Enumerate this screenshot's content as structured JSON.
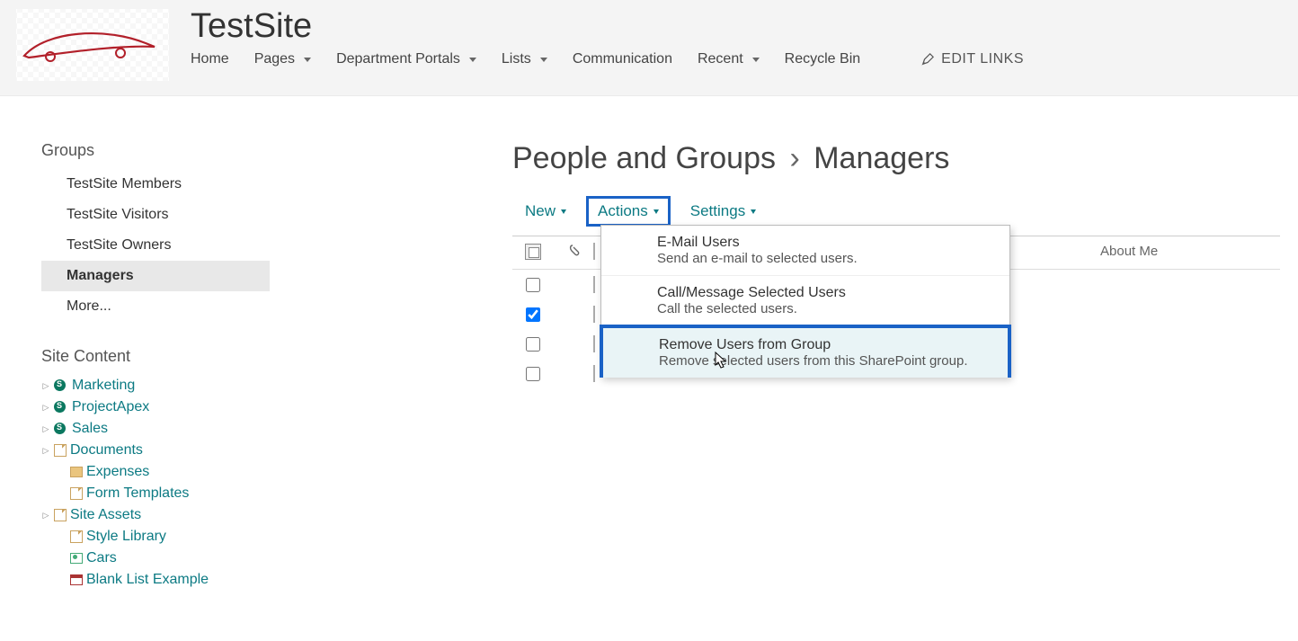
{
  "site_title": "TestSite",
  "top_nav": {
    "items": [
      {
        "label": "Home",
        "dropdown": false
      },
      {
        "label": "Pages",
        "dropdown": true
      },
      {
        "label": "Department Portals",
        "dropdown": true
      },
      {
        "label": "Lists",
        "dropdown": true
      },
      {
        "label": "Communication",
        "dropdown": false
      },
      {
        "label": "Recent",
        "dropdown": true
      },
      {
        "label": "Recycle Bin",
        "dropdown": false
      }
    ],
    "edit_links": "EDIT LINKS"
  },
  "sidebar": {
    "groups_heading": "Groups",
    "groups": [
      {
        "label": "TestSite Members",
        "active": false
      },
      {
        "label": "TestSite Visitors",
        "active": false
      },
      {
        "label": "TestSite Owners",
        "active": false
      },
      {
        "label": "Managers",
        "active": true
      },
      {
        "label": "More...",
        "active": false
      }
    ],
    "site_content_heading": "Site Content",
    "site_content": [
      {
        "label": "Marketing",
        "icon": "site",
        "tri": true,
        "indent": false
      },
      {
        "label": "ProjectApex",
        "icon": "site",
        "tri": true,
        "indent": false
      },
      {
        "label": "Sales",
        "icon": "site",
        "tri": true,
        "indent": false
      },
      {
        "label": "Documents",
        "icon": "doc",
        "tri": true,
        "indent": false
      },
      {
        "label": "Expenses",
        "icon": "folder",
        "tri": false,
        "indent": true
      },
      {
        "label": "Form Templates",
        "icon": "doc",
        "tri": false,
        "indent": true
      },
      {
        "label": "Site Assets",
        "icon": "doc",
        "tri": true,
        "indent": false
      },
      {
        "label": "Style Library",
        "icon": "doc",
        "tri": false,
        "indent": true
      },
      {
        "label": "Cars",
        "icon": "img",
        "tri": false,
        "indent": true
      },
      {
        "label": "Blank List Example",
        "icon": "cal",
        "tri": false,
        "indent": true
      }
    ]
  },
  "main": {
    "title_prefix": "People and Groups",
    "title_current": "Managers",
    "toolbar": {
      "new": "New",
      "actions": "Actions",
      "settings": "Settings"
    },
    "columns": {
      "about": "About Me"
    },
    "rows": [
      {
        "checked": false
      },
      {
        "checked": true
      },
      {
        "checked": false
      },
      {
        "checked": false
      }
    ],
    "dropdown": [
      {
        "title": "E-Mail Users",
        "desc": "Send an e-mail to selected users.",
        "highlight": false
      },
      {
        "title": "Call/Message Selected Users",
        "desc": "Call the selected users.",
        "highlight": false
      },
      {
        "title": "Remove Users from Group",
        "desc": "Remove selected users from this SharePoint group.",
        "highlight": true
      }
    ]
  }
}
